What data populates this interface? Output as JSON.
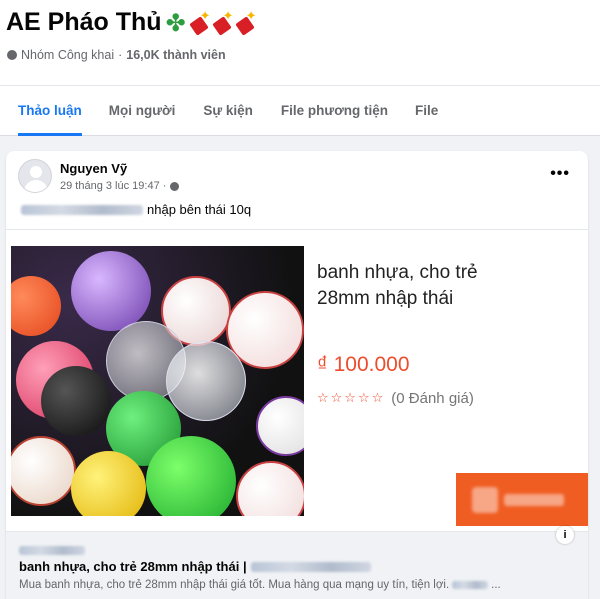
{
  "group": {
    "title": "AE Pháo Thủ",
    "title_emojis": [
      "four-leaf-clover-icon",
      "firecracker-icon",
      "firecracker-icon",
      "firecracker-icon"
    ],
    "privacy": "Nhóm Công khai",
    "separator": "·",
    "members": "16,0K thành viên"
  },
  "tabs": [
    {
      "label": "Thảo luận",
      "active": true
    },
    {
      "label": "Mọi người",
      "active": false
    },
    {
      "label": "Sự kiện",
      "active": false
    },
    {
      "label": "File phương tiện",
      "active": false
    },
    {
      "label": "File",
      "active": false
    }
  ],
  "post": {
    "author": "Nguyen Vỹ",
    "time": "29 tháng 3 lúc 19:47 ·",
    "more_label": "•••",
    "text_visible": "nhập bên thái 10q"
  },
  "product": {
    "name_line1": "banh nhựa, cho trẻ",
    "name_line2": "28mm nhập thái",
    "price": "₫ 100.000",
    "stars": "☆☆☆☆☆",
    "rating_text": "(0 Đánh giá)"
  },
  "link_preview": {
    "title": "banh nhựa, cho trẻ 28mm nhập thái |",
    "description": "Mua banh nhựa, cho trẻ 28mm nhập thái giá tốt. Mua hàng qua mạng uy tín, tiện lợi.",
    "ellipsis": "...",
    "info_label": "i"
  },
  "colors": {
    "accent": "#1877f2",
    "price": "#ee4d2d",
    "banner": "#f05d23"
  }
}
